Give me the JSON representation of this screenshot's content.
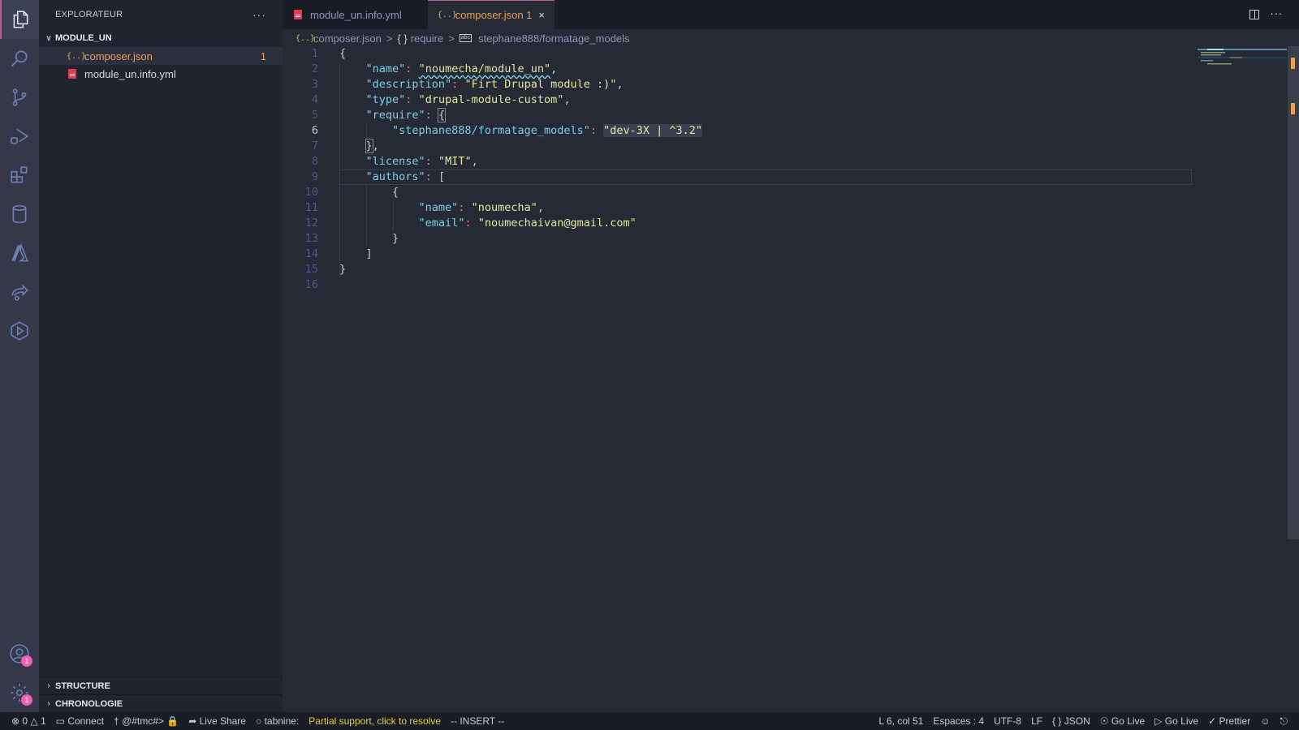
{
  "activity_bar": {
    "items": [
      {
        "name": "explorer",
        "active": true
      },
      {
        "name": "search"
      },
      {
        "name": "source-control"
      },
      {
        "name": "run-debug"
      },
      {
        "name": "extensions"
      },
      {
        "name": "database"
      },
      {
        "name": "azure"
      },
      {
        "name": "live-share"
      },
      {
        "name": "remote"
      }
    ],
    "accounts_badge": "1",
    "settings_badge": "1"
  },
  "sidebar": {
    "title": "EXPLORATEUR",
    "more": "···",
    "folder": "MODULE_UN",
    "files": [
      {
        "name": "composer.json",
        "icon": "json-icon",
        "problems": "1",
        "selected": true
      },
      {
        "name": "module_un.info.yml",
        "icon": "yaml-file-icon"
      }
    ],
    "sections": [
      "STRUCTURE",
      "CHRONOLOGIE"
    ]
  },
  "tabs": [
    {
      "label": "module_un.info.yml",
      "icon": "yaml-file-icon"
    },
    {
      "label": "composer.json 1",
      "icon": "json-icon",
      "active": true,
      "close": "×"
    }
  ],
  "breadcrumbs": {
    "file": "composer.json",
    "object": "require",
    "key": "stephane888/formatage_models",
    "sep": ">"
  },
  "editor": {
    "line_numbers": [
      "1",
      "2",
      "3",
      "4",
      "5",
      "6",
      "7",
      "8",
      "9",
      "10",
      "11",
      "12",
      "13",
      "14",
      "15",
      "16"
    ],
    "current_line": 6,
    "lines": {
      "l1": "{",
      "l2k": "\"name\"",
      "l2v": "\"noumecha/module_un\"",
      "l3k": "\"description\"",
      "l3v": "\"Firt Drupal module :)\"",
      "l4k": "\"type\"",
      "l4v": "\"drupal-module-custom\"",
      "l5k": "\"require\"",
      "l5b": "{",
      "l6k": "\"stephane888/formatage_models\"",
      "l6v1": "\"dev-3X | ",
      "l6v2": "^3.2\"",
      "l7": "}",
      "l8k": "\"license\"",
      "l8v": "\"MIT\"",
      "l9k": "\"authors\"",
      "l9b": "[",
      "l10": "{",
      "l11k": "\"name\"",
      "l11v": "\"noumecha\"",
      "l12k": "\"email\"",
      "l12v": "\"noumechaivan@gmail.com\"",
      "l13": "}",
      "l14": "]",
      "l15": "}"
    }
  },
  "statusbar": {
    "errors": "0",
    "warnings": "1",
    "connect": "Connect",
    "tmc": "@#tmc#>",
    "live_share": "Live Share",
    "tabnine": "tabnine:",
    "tabnine_msg": "Partial support, click to resolve",
    "mode": "-- INSERT --",
    "position": "L 6, col 51",
    "spaces": "Espaces : 4",
    "encoding": "UTF-8",
    "eol": "LF",
    "language": "JSON",
    "go_live_1": "Go Live",
    "go_live_2": "Go Live",
    "prettier": "Prettier"
  },
  "colors": {
    "accent": "#c2589a",
    "modified": "#e8a15a",
    "badge": "#f05fb0",
    "key": "#7dcfe6",
    "string": "#e4e6a0"
  }
}
